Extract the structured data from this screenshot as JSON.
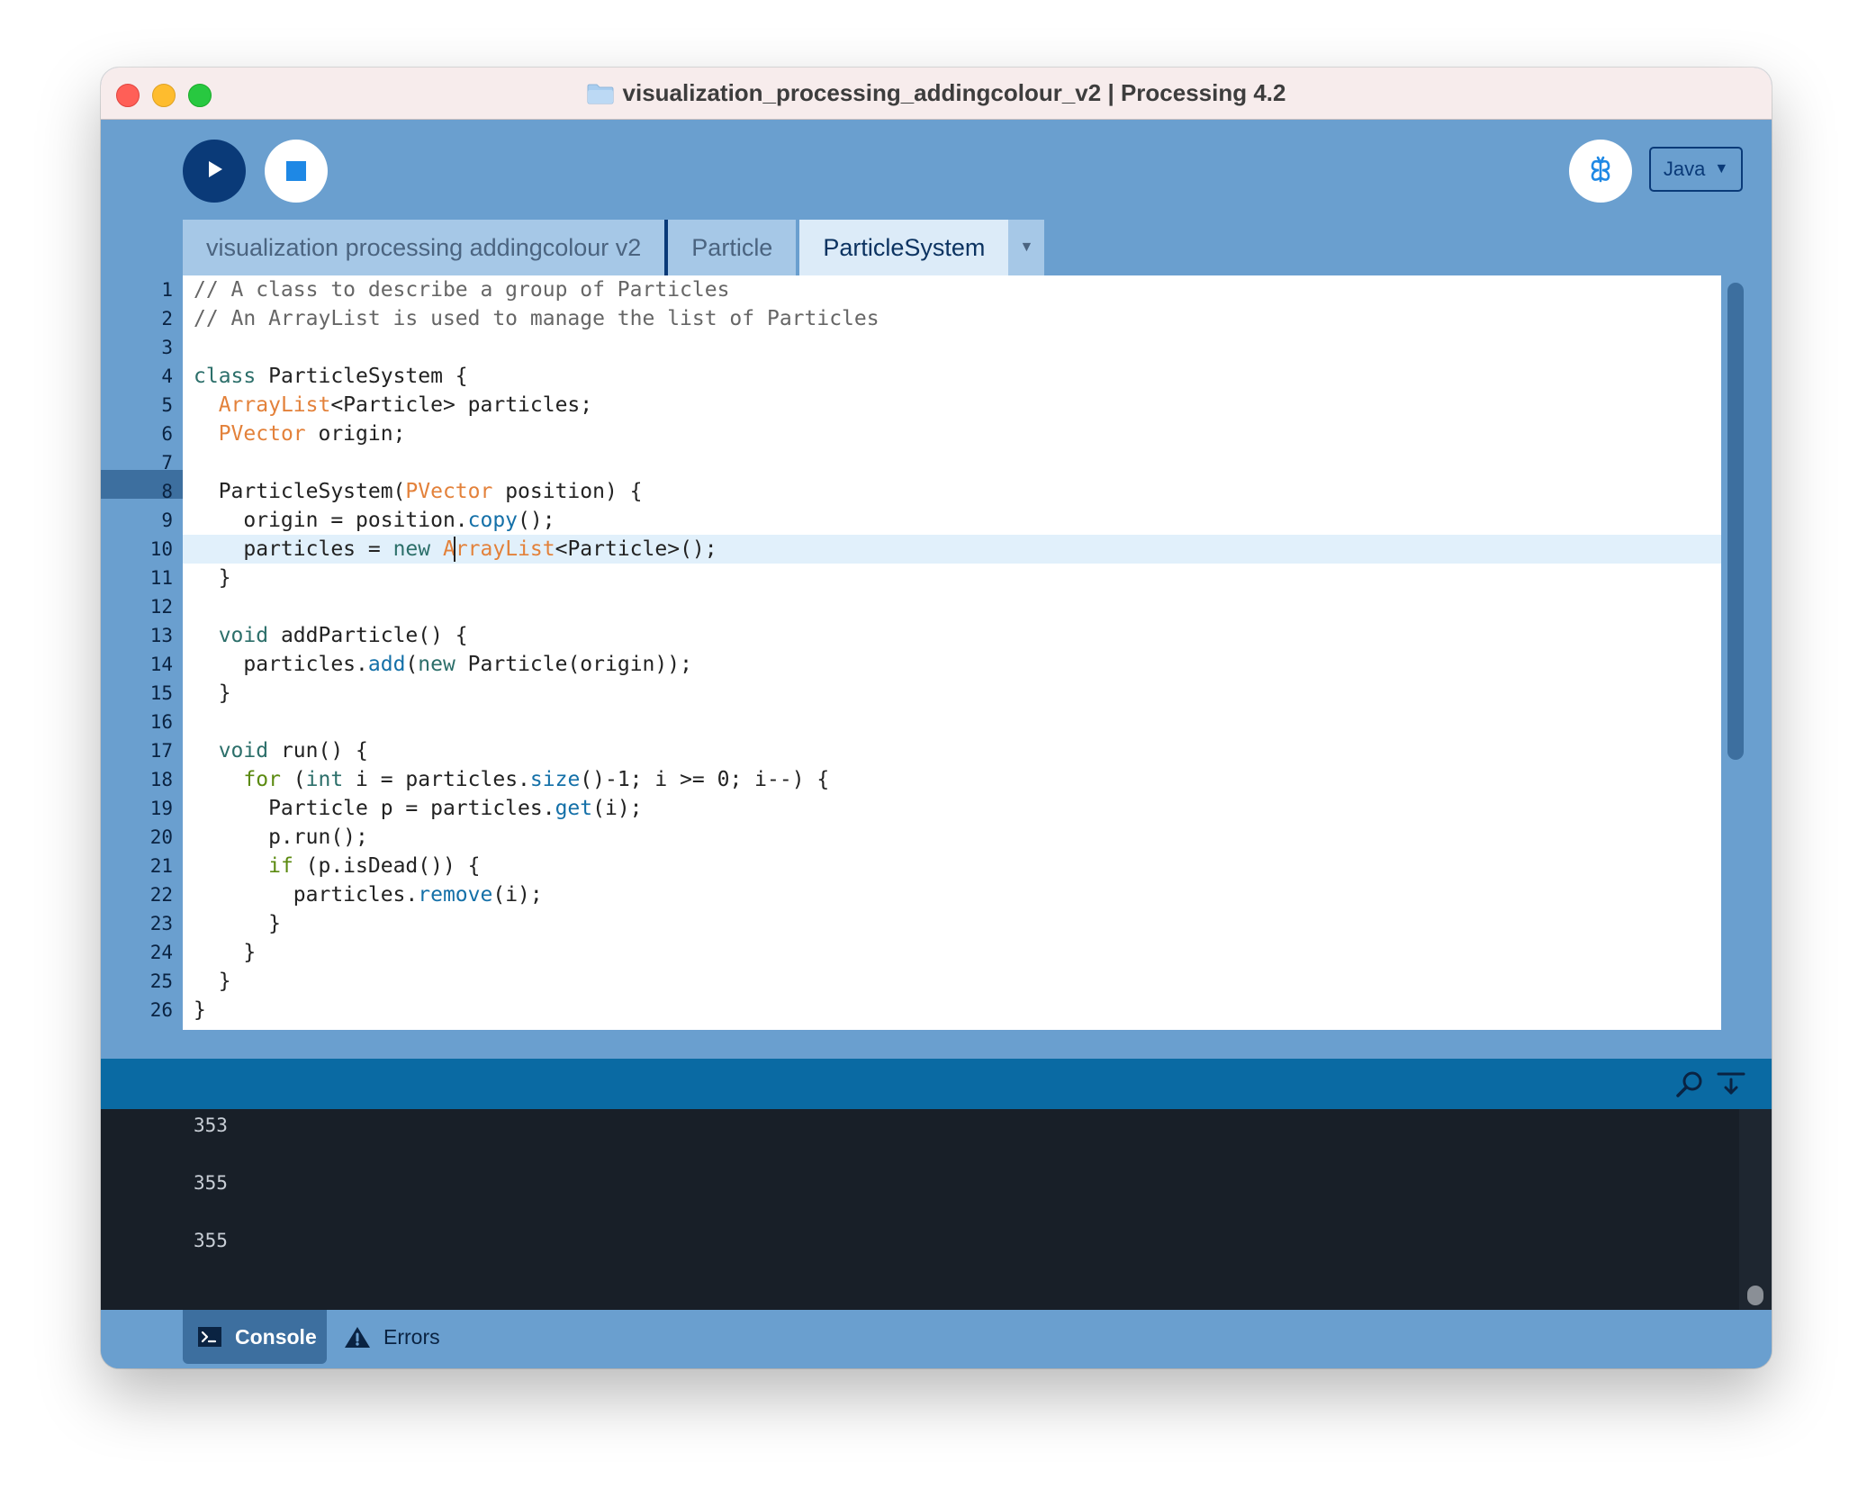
{
  "window": {
    "title": "visualization_processing_addingcolour_v2 | Processing 4.2"
  },
  "toolbar": {
    "run_icon": "play-icon",
    "stop_icon": "stop-icon",
    "debug_icon": "butterfly-icon",
    "mode": "Java"
  },
  "tabs": [
    {
      "label": "visualization processing addingcolour v2",
      "active": false
    },
    {
      "label": "Particle",
      "active": false
    },
    {
      "label": "ParticleSystem",
      "active": true
    }
  ],
  "editor": {
    "current_line": "10",
    "line_numbers": [
      "1",
      "2",
      "3",
      "4",
      "5",
      "6",
      "7",
      "8",
      "9",
      "10",
      "11",
      "12",
      "13",
      "14",
      "15",
      "16",
      "17",
      "18",
      "19",
      "20",
      "21",
      "22",
      "23",
      "24",
      "25",
      "26"
    ],
    "lines": [
      "// A class to describe a group of Particles",
      "// An ArrayList is used to manage the list of Particles",
      "",
      "class ParticleSystem {",
      "  ArrayList<Particle> particles;",
      "  PVector origin;",
      "",
      "  ParticleSystem(PVector position) {",
      "    origin = position.copy();",
      "    particles = new ArrayList<Particle>();",
      "  }",
      "",
      "  void addParticle() {",
      "    particles.add(new Particle(origin));",
      "  }",
      "",
      "  void run() {",
      "    for (int i = particles.size()-1; i >= 0; i--) {",
      "      Particle p = particles.get(i);",
      "      p.run();",
      "      if (p.isDead()) {",
      "        particles.remove(i);",
      "      }",
      "    }",
      "  }",
      "}"
    ]
  },
  "console": {
    "output": [
      "353",
      "355",
      "355"
    ],
    "search_icon": "search-icon",
    "clear_icon": "clear-console-icon"
  },
  "bottom_tabs": {
    "console_label": "Console",
    "errors_label": "Errors"
  }
}
